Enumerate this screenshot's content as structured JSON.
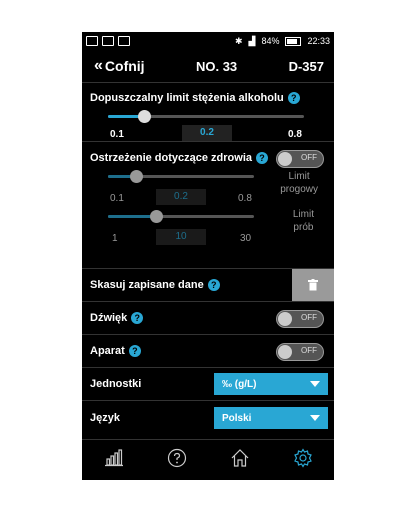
{
  "status_bar": {
    "battery_text": "84%",
    "time": "22:33"
  },
  "header": {
    "back_label": "Cofnij",
    "number": "NO. 33",
    "device": "D-357"
  },
  "alcohol_limit": {
    "title": "Dopuszczalny limit stężenia alkoholu",
    "min_label": "0.1",
    "value_label": "0.2",
    "max_label": "0.8",
    "value": 0.2,
    "min": 0.1,
    "max": 0.8
  },
  "health_warning": {
    "title": "Ostrzeżenie dotyczące zdrowia",
    "toggle_text": "OFF",
    "threshold": {
      "label_line1": "Limit",
      "label_line2": "progowy",
      "min_label": "0.1",
      "value_label": "0.2",
      "max_label": "0.8"
    },
    "tests": {
      "label_line1": "Limit",
      "label_line2": "prób",
      "min_label": "1",
      "value_label": "10",
      "max_label": "30"
    }
  },
  "clear_data": {
    "label": "Skasuj zapisane dane"
  },
  "sound": {
    "label": "Dźwięk",
    "toggle_text": "OFF"
  },
  "camera": {
    "label": "Aparat",
    "toggle_text": "OFF"
  },
  "units": {
    "label": "Jednostki",
    "value": "‰ (g/L)"
  },
  "language": {
    "label": "Język",
    "value": "Polski"
  },
  "nav": {
    "icons": [
      "chart-icon",
      "help-icon",
      "home-icon",
      "settings-icon"
    ]
  },
  "colors": {
    "accent": "#29a7d4",
    "background": "#000000",
    "delete_button": "#9a9a9a"
  }
}
